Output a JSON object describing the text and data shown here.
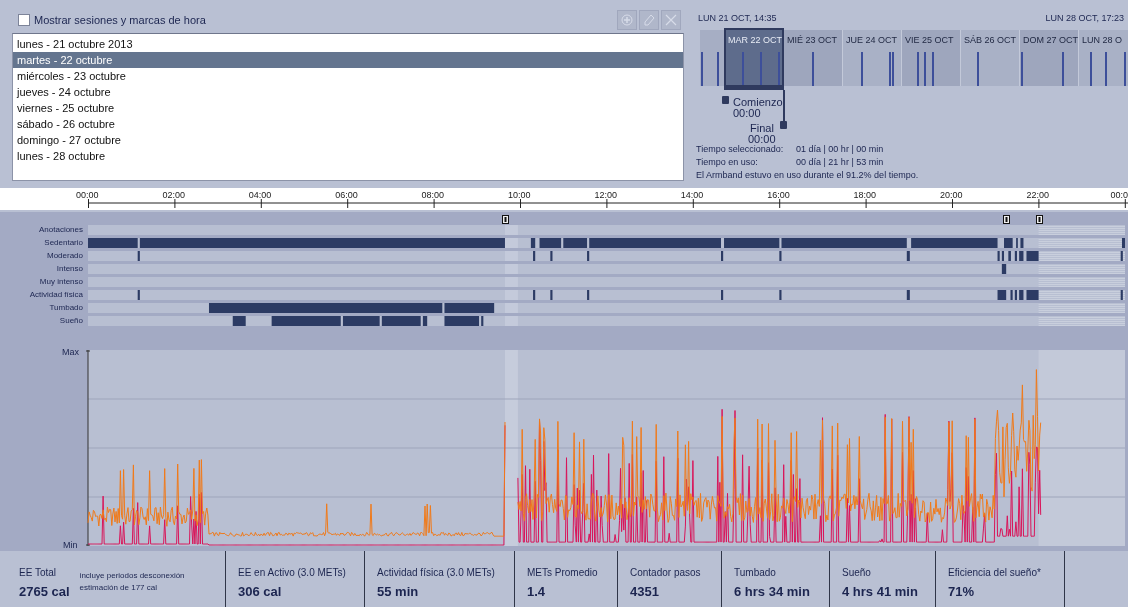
{
  "show_sessions": {
    "label": "Mostrar sesiones y marcas de hora",
    "checked": false
  },
  "toolbar_buttons": [
    {
      "kind": "add",
      "disabled": true
    },
    {
      "kind": "edit",
      "disabled": true
    },
    {
      "kind": "delete",
      "disabled": true
    }
  ],
  "days": [
    {
      "label": "lunes - 21 octubre 2013",
      "selected": false
    },
    {
      "label": "martes - 22 octubre",
      "selected": true
    },
    {
      "label": "miércoles - 23 octubre",
      "selected": false
    },
    {
      "label": "jueves - 24 octubre",
      "selected": false
    },
    {
      "label": "viernes - 25 octubre",
      "selected": false
    },
    {
      "label": "sábado - 26 octubre",
      "selected": false
    },
    {
      "label": "domingo - 27 octubre",
      "selected": false
    },
    {
      "label": "lunes - 28 octubre",
      "selected": false
    }
  ],
  "range_overview": {
    "start_label": "LUN 21 OCT, 14:35",
    "end_label": "LUN 28 OCT, 17:23",
    "days": [
      {
        "label": "MAR 22 OCT",
        "selected": true
      },
      {
        "label": "MIÉ 23 OCT",
        "selected": false
      },
      {
        "label": "JUE 24 OCT",
        "selected": false
      },
      {
        "label": "VIE 25 OCT",
        "selected": false
      },
      {
        "label": "SÁB 26 OCT",
        "selected": false
      },
      {
        "label": "DOM 27 OCT",
        "selected": false
      },
      {
        "label": "LUN 28 O",
        "selected": false
      }
    ],
    "start_handle": {
      "label": "Comienzo",
      "time": "00:00"
    },
    "end_handle": {
      "label": "Final",
      "time": "00:00"
    }
  },
  "summary": [
    {
      "label": "Tiempo seleccionado:",
      "value": "01 día | 00 hr | 00 min"
    },
    {
      "label": "Tiempo en uso:",
      "value": "00 día | 21 hr | 53 min"
    }
  ],
  "usage_note": "El Armband estuvo en uso durante el 91.2% del tiempo.",
  "time_axis": [
    "00:00",
    "02:00",
    "04:00",
    "06:00",
    "08:00",
    "10:00",
    "12:00",
    "14:00",
    "16:00",
    "18:00",
    "20:00",
    "22:00",
    "00:0"
  ],
  "activity_rows": [
    "Anotaciones",
    "Sedentario",
    "Moderado",
    "Intenso",
    "Muy intenso",
    "Actividad física",
    "Tumbado",
    "Sueño"
  ],
  "chart": {
    "max_label": "Max",
    "min_label": "Min"
  },
  "stats": [
    {
      "label": "EE Total",
      "value": "2765 cal",
      "note_lines": [
        "incluye periodos desconexión",
        "estimación de 177 cal"
      ]
    },
    {
      "label": "EE en Activo (3.0 METs)",
      "value": "306 cal"
    },
    {
      "label": "Actividad física (3.0 METs)",
      "value": "55 min"
    },
    {
      "label": "METs Promedio",
      "value": "1.4"
    },
    {
      "label": "Contador pasos",
      "value": "4351"
    },
    {
      "label": "Tumbado",
      "value": "6 hrs 34 min"
    },
    {
      "label": "Sueño",
      "value": "4 hrs 41 min"
    },
    {
      "label": "Eficiencia del sueño*",
      "value": "71%"
    }
  ]
}
